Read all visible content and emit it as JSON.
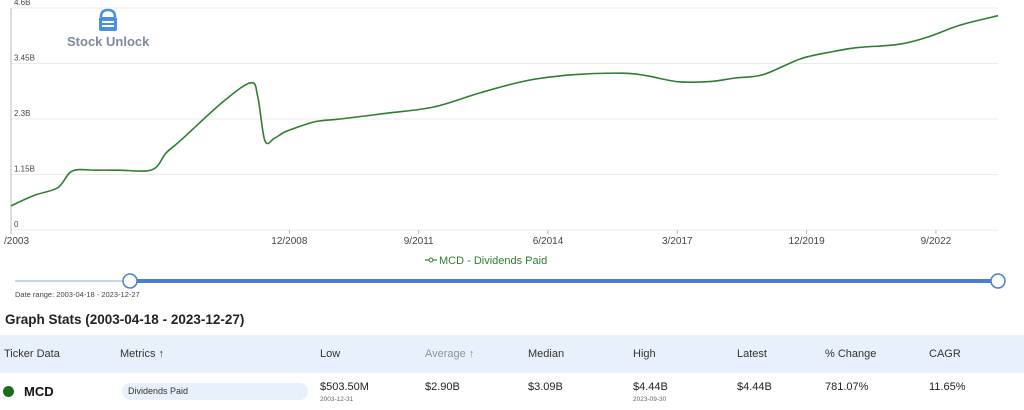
{
  "chart_data": {
    "type": "line",
    "title": "",
    "xlabel": "",
    "ylabel": "",
    "ylim": [
      0,
      4.6
    ],
    "y_unit": "B",
    "y_ticks": [
      "0",
      "1.15B",
      "2.3B",
      "3.45B",
      "4.6B"
    ],
    "y_tick_values": [
      0,
      1.15,
      2.3,
      3.45,
      4.6
    ],
    "x_ticks": [
      "/2003",
      "12/2008",
      "9/2011",
      "6/2014",
      "3/2017",
      "12/2019",
      "9/2022"
    ],
    "x_tick_values": [
      2003.0,
      2008.92,
      2011.67,
      2014.42,
      2017.17,
      2019.92,
      2022.67
    ],
    "xlim": [
      2003.0,
      2023.99
    ],
    "grid": true,
    "legend": "bottom-center",
    "series": [
      {
        "name": "MCD - Dividends Paid",
        "color": "#2e7d32",
        "x": [
          2003.0,
          2003.5,
          2004.0,
          2004.3,
          2004.8,
          2005.3,
          2006.0,
          2006.3,
          2006.6,
          2007.5,
          2008.1,
          2008.25,
          2008.4,
          2008.6,
          2008.8,
          2009.0,
          2009.5,
          2010.0,
          2011.0,
          2012.0,
          2013.0,
          2014.0,
          2015.0,
          2016.0,
          2016.5,
          2017.2,
          2017.9,
          2018.4,
          2019.0,
          2019.8,
          2020.5,
          2021.0,
          2021.9,
          2022.5,
          2023.2,
          2023.99
        ],
        "y": [
          0.5,
          0.72,
          0.88,
          1.22,
          1.24,
          1.24,
          1.25,
          1.6,
          1.85,
          2.65,
          3.05,
          2.75,
          1.85,
          1.9,
          2.02,
          2.1,
          2.25,
          2.3,
          2.42,
          2.55,
          2.85,
          3.1,
          3.22,
          3.25,
          3.2,
          3.07,
          3.08,
          3.15,
          3.22,
          3.55,
          3.7,
          3.78,
          3.85,
          4.0,
          4.25,
          4.44
        ]
      }
    ]
  },
  "watermark": {
    "text": "Stock Unlock",
    "icon": "lock-icon"
  },
  "range": {
    "caption_label": "Date range:",
    "start": "2003-04-18",
    "separator": " - ",
    "end": "2023-12-27",
    "start_fraction": 0.0,
    "end_fraction": 1.0
  },
  "stats": {
    "title": "Graph Stats (2003-04-18 - 2023-12-27)",
    "headers": {
      "ticker": "Ticker Data",
      "metrics": "Metrics ↑",
      "low": "Low",
      "average": "Average ↑",
      "median": "Median",
      "high": "High",
      "latest": "Latest",
      "change": "% Change",
      "cagr": "CAGR"
    },
    "row": {
      "dot_color": "#1b6e1b",
      "ticker": "MCD",
      "metric": "Dividends Paid",
      "low": "$503.50M",
      "low_date": "2003-12-31",
      "average": "$2.90B",
      "median": "$3.09B",
      "high": "$4.44B",
      "high_date": "2023-09-30",
      "latest": "$4.44B",
      "change": "781.07%",
      "cagr": "11.65%"
    }
  }
}
